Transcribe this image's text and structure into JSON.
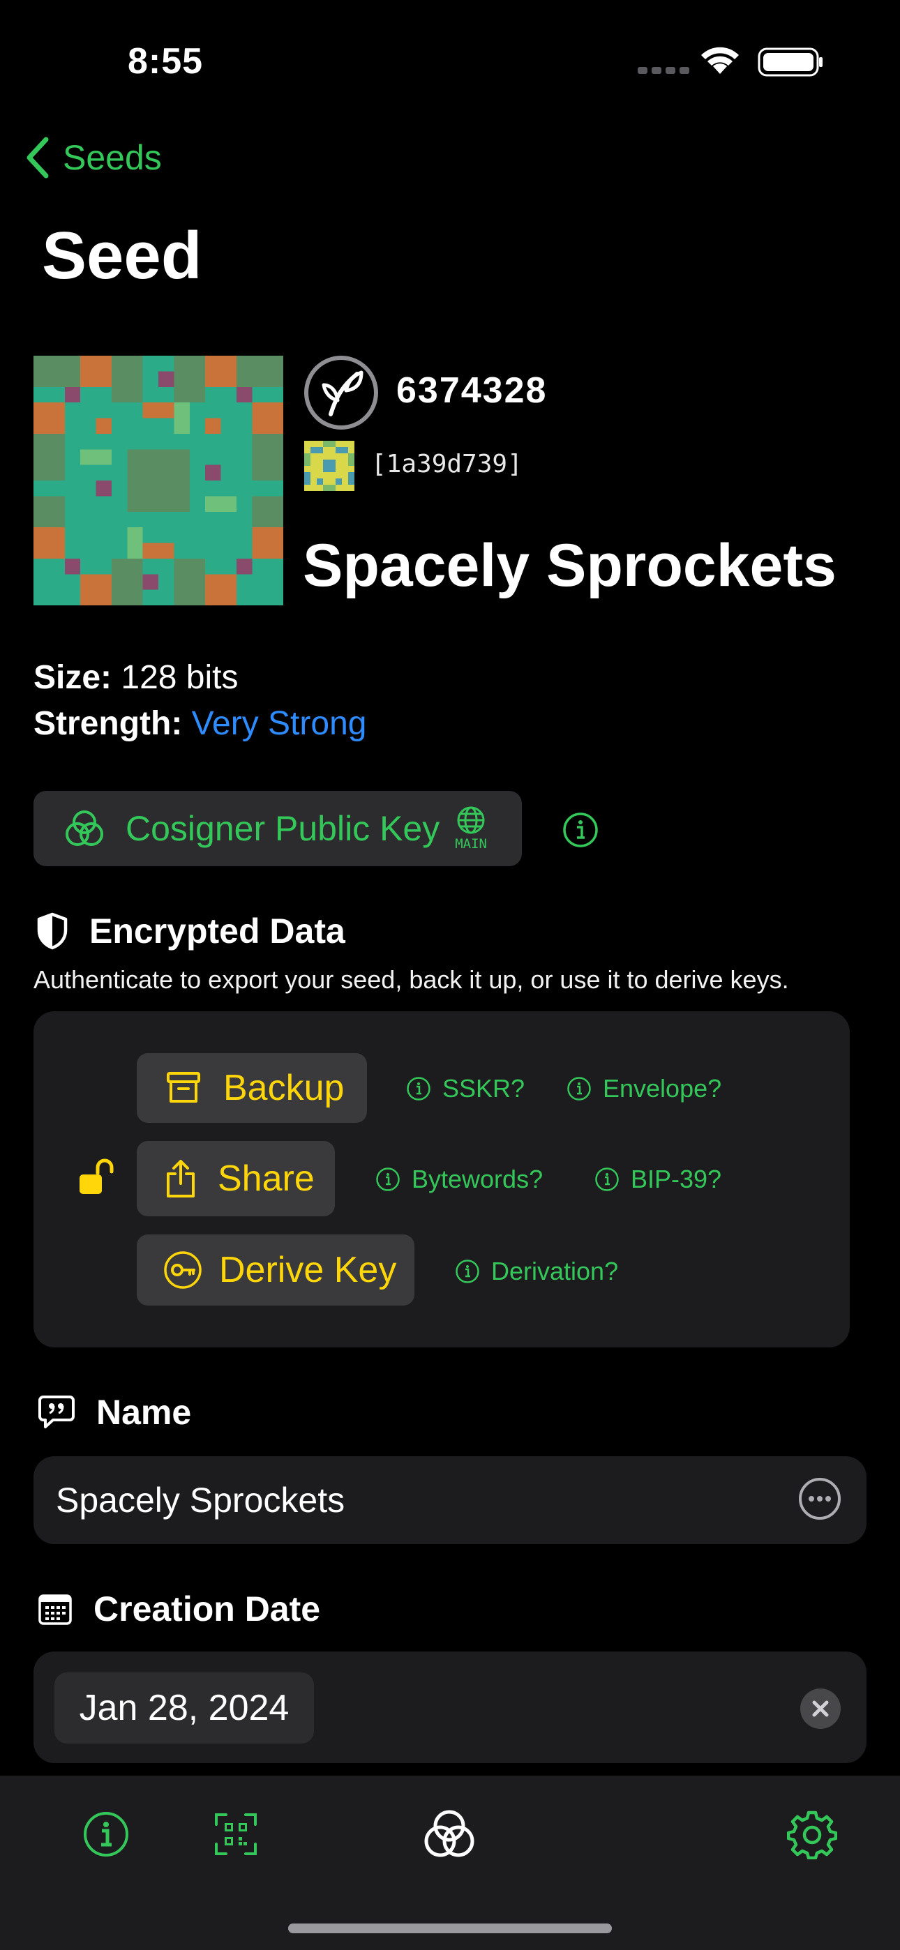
{
  "status_bar": {
    "time": "8:55"
  },
  "nav": {
    "back_label": "Seeds",
    "title": "Seed"
  },
  "seed": {
    "id": "6374328",
    "fingerprint": "[1a39d739]",
    "name": "Spacely Sprockets",
    "size_label": "Size:",
    "size_value": "128 bits",
    "strength_label": "Strength:",
    "strength_value": "Very Strong"
  },
  "cosigner": {
    "label": "Cosigner Public Key",
    "network_badge": "MAIN"
  },
  "encrypted": {
    "title": "Encrypted Data",
    "description": "Authenticate to export your seed, back it up, or use it to derive keys.",
    "buttons": {
      "backup": "Backup",
      "share": "Share",
      "derive": "Derive Key"
    },
    "links": {
      "sskr": "SSKR?",
      "envelope": "Envelope?",
      "bytewords": "Bytewords?",
      "bip39": "BIP-39?",
      "derivation": "Derivation?"
    }
  },
  "name_section": {
    "title": "Name",
    "value": "Spacely Sprockets"
  },
  "date_section": {
    "title": "Creation Date",
    "value": "Jan 28, 2024"
  },
  "colors": {
    "accent": "#34c759",
    "action": "#ffd60a",
    "strength": "#2f8cff"
  }
}
